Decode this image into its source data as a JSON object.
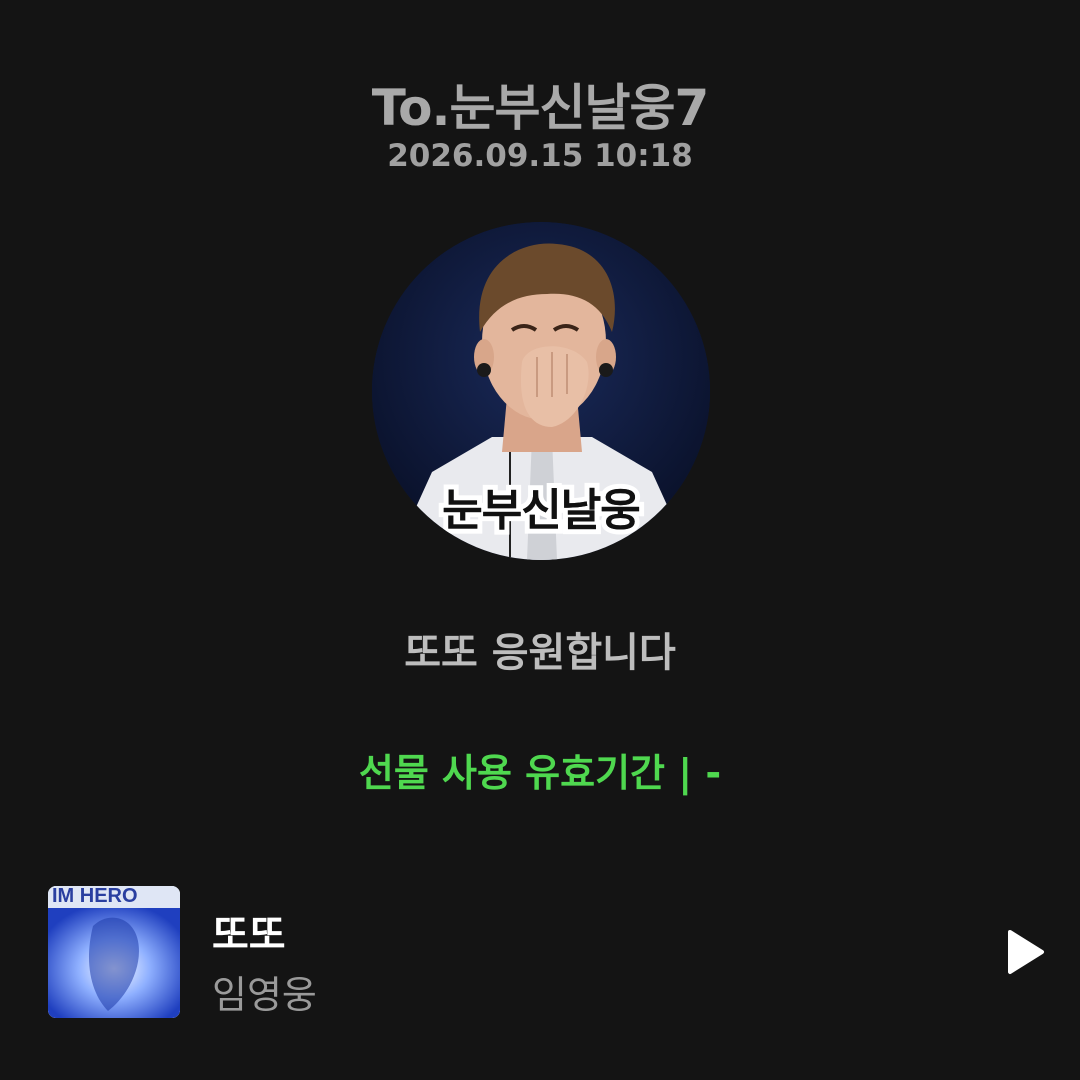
{
  "header": {
    "recipient": "To.눈부신날웅7",
    "timestamp": "2026.09.15 10:18"
  },
  "profile": {
    "caption": "눈부신날웅"
  },
  "message": "또또 응원합니다",
  "gift": {
    "validity": "선물 사용 유효기간 |   -"
  },
  "track": {
    "title": "또또",
    "artist": "임영웅",
    "album_art_text": "IM HERO"
  },
  "icons": {
    "play": "play-icon"
  },
  "colors": {
    "background": "#141414",
    "accent_green": "#4fd84f",
    "muted_text": "#a9a9a9"
  }
}
